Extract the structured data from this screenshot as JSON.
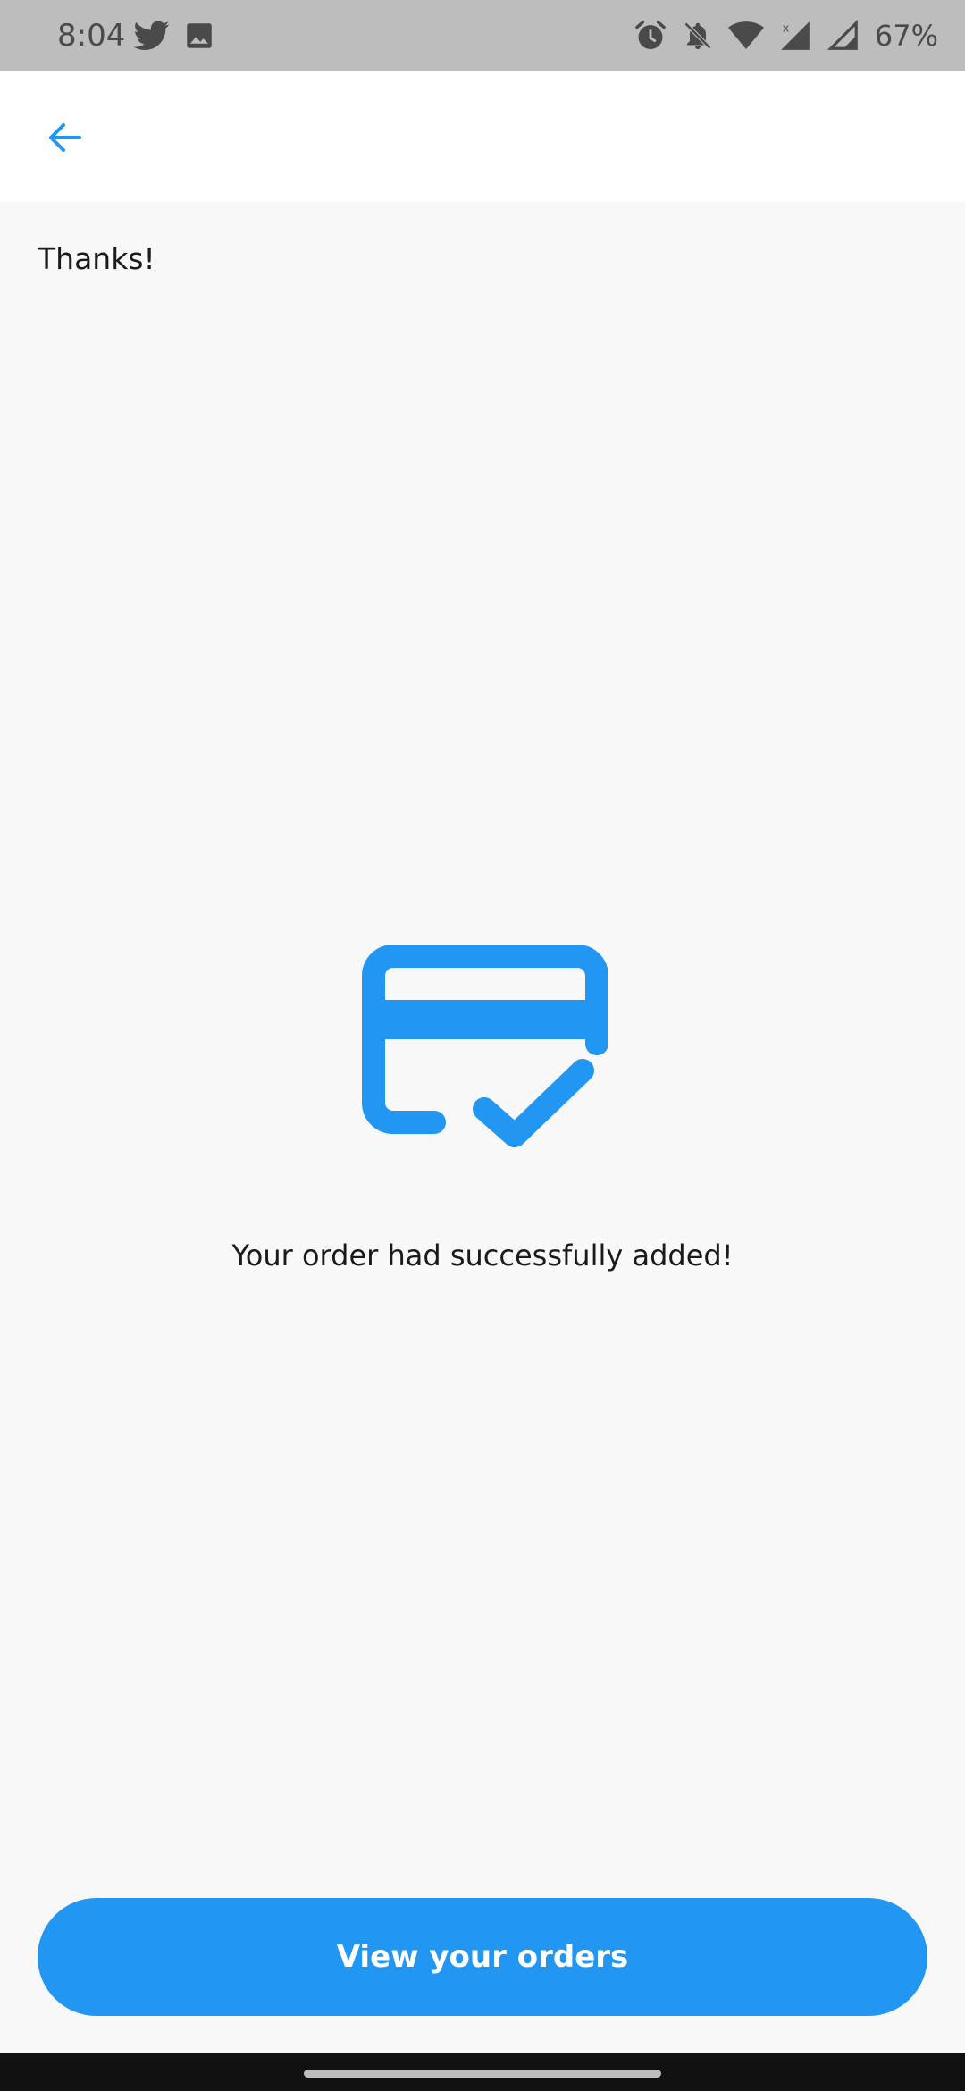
{
  "status_bar": {
    "time": "8:04",
    "battery": "67%",
    "left_icons": [
      "twitter-icon",
      "image-icon"
    ],
    "right_icons": [
      "alarm-icon",
      "notifications-off-icon",
      "wifi-icon",
      "signal-icon",
      "signal-icon-2"
    ]
  },
  "app_bar": {
    "back_icon": "arrow-back-icon",
    "accent": "#2196f3"
  },
  "main": {
    "title": "Thanks!",
    "hero_icon": "credit-card-check-icon",
    "message": "Your order had successfully added!"
  },
  "actions": {
    "view_orders_label": "View your orders",
    "button_color": "#2196f3"
  }
}
